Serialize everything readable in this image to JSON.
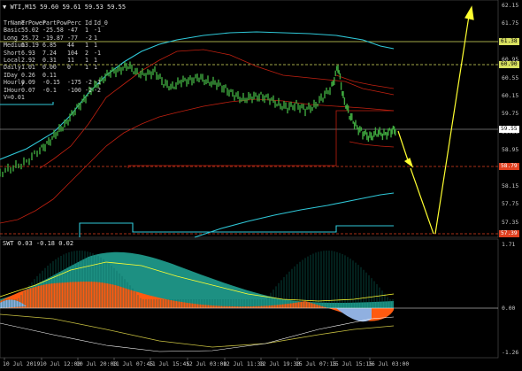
{
  "chart_title": "WTI,M15  59.60 59.61 59.53 59.55",
  "indicator_title": "SWT 0.03 -0.18 0.02",
  "table": {
    "headers": [
      "TrName",
      "TrPower",
      "PartPow",
      "Perc",
      "Id",
      "Id_0"
    ],
    "rows": [
      [
        "Basic",
        "55.02",
        "-25.58",
        "-47",
        "1",
        "-1"
      ],
      [
        "Long",
        "25.72",
        "-19.87",
        "-77",
        "-2",
        "1"
      ],
      [
        "Medium",
        "13.19",
        "6.85",
        "44",
        "1",
        "1"
      ],
      [
        "Short",
        "6.93",
        "7.24",
        "104",
        "2",
        "-1"
      ],
      [
        "Local",
        "2.92",
        "0.31",
        "11",
        "1",
        "1"
      ],
      [
        "Daily",
        "1.01",
        "0.00",
        "0",
        "1",
        "1"
      ],
      [
        "IDay",
        "0.26",
        "0.11",
        "",
        "",
        ""
      ],
      [
        "Hourly",
        "0.09",
        "-0.15",
        "-175",
        "-2",
        "-1"
      ],
      [
        "IHour",
        "0.07",
        "-0.1",
        "-100",
        "-2",
        "-2"
      ]
    ],
    "footer": "V=0.01"
  },
  "price_axis": {
    "ticks": [
      "62.15",
      "61.75",
      "61.35",
      "60.95",
      "60.55",
      "60.15",
      "59.75",
      "59.35",
      "58.95",
      "58.55",
      "58.15",
      "57.75",
      "57.35"
    ],
    "tags": [
      {
        "label": "61.38",
        "color": "#d8e060",
        "text_color": "#000"
      },
      {
        "label": "60.90",
        "color": "#d8e060",
        "text_color": "#000"
      },
      {
        "label": "59.55",
        "color": "#ffffff",
        "text_color": "#000"
      },
      {
        "label": "58.79",
        "color": "#e04020",
        "text_color": "#fff"
      },
      {
        "label": "57.39",
        "color": "#e04020",
        "text_color": "#fff"
      }
    ]
  },
  "indicator_axis": {
    "ticks": [
      "1.71",
      "0.00",
      "-1.26"
    ]
  },
  "time_axis": {
    "labels": [
      "10 Jul 2019",
      "10 Jul 12:00",
      "10 Jul 20:00",
      "11 Jul 07:45",
      "11 Jul 15:45",
      "12 Jul 03:00",
      "12 Jul 11:30",
      "12 Jul 19:30",
      "15 Jul 07:15",
      "15 Jul 15:15",
      "16 Jul 03:00"
    ]
  },
  "colors": {
    "background": "#000000",
    "grid": "#3a3a3a",
    "candles": "#3fa83f",
    "level_yellow": "#d8e060",
    "ma_cyan": "#2fc8d8",
    "ma_red": "#c02010",
    "indicator_teal": "#20a090",
    "indicator_orange": "#ff5a10",
    "indicator_blue": "#90b0e0",
    "arrow": "#ffff30"
  }
}
